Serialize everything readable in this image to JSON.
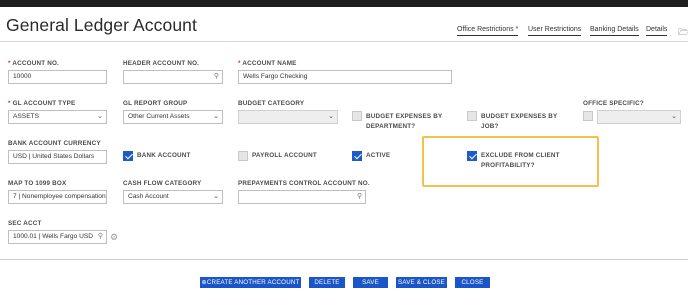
{
  "page": {
    "title": "General Ledger Account"
  },
  "tabs": [
    {
      "label": "Office Restrictions *"
    },
    {
      "label": "User Restrictions"
    },
    {
      "label": "Banking Details"
    },
    {
      "label": "Details"
    }
  ],
  "fields": {
    "account_no": {
      "label": "ACCOUNT NO.",
      "value": "10000"
    },
    "header_account_no": {
      "label": "HEADER ACCOUNT NO.",
      "value": ""
    },
    "account_name": {
      "label": "ACCOUNT NAME",
      "value": "Wells Fargo Checking"
    },
    "gl_account_type": {
      "label": "GL ACCOUNT TYPE",
      "value": "ASSETS"
    },
    "gl_report_group": {
      "label": "GL REPORT GROUP",
      "value": "Other Current Assets"
    },
    "budget_category": {
      "label": "BUDGET CATEGORY",
      "value": ""
    },
    "budget_expenses_department": {
      "label_line1": "BUDGET EXPENSES BY",
      "label_line2": "DEPARTMENT?",
      "checked": false
    },
    "budget_expenses_job": {
      "label_line1": "BUDGET EXPENSES BY",
      "label_line2": "JOB?",
      "checked": false
    },
    "office_specific": {
      "label": "OFFICE SPECIFIC?",
      "value": ""
    },
    "bank_account_currency": {
      "label": "BANK ACCOUNT CURRENCY",
      "value": "USD | United States Dollars"
    },
    "bank_account": {
      "label": "BANK ACCOUNT",
      "checked": true
    },
    "payroll_account": {
      "label": "PAYROLL ACCOUNT",
      "checked": false
    },
    "active": {
      "label": "ACTIVE",
      "checked": true
    },
    "exclude_profitability": {
      "label_line1": "EXCLUDE FROM CLIENT",
      "label_line2": "PROFITABILITY?",
      "checked": true
    },
    "map_1099": {
      "label": "MAP TO 1099 BOX",
      "value": "7 | Nonemployee compensation"
    },
    "cash_flow_category": {
      "label": "CASH FLOW CATEGORY",
      "value": "Cash Account"
    },
    "prepayments_control": {
      "label": "PREPAYMENTS CONTROL ACCOUNT NO.",
      "value": ""
    },
    "sec_acct": {
      "label": "SEC ACCT",
      "value": "1000.01 | Wells Fargo USD"
    }
  },
  "buttons": {
    "create_another": "CREATE ANOTHER ACCOUNT",
    "delete": "DELETE",
    "save": "SAVE",
    "save_close": "SAVE & CLOSE",
    "close": "CLOSE"
  },
  "icons": {
    "search": "search-icon",
    "dropdown": "chevron-down-icon",
    "gear": "gear-icon",
    "folder": "folder-icon",
    "add": "plus-circle-icon"
  },
  "colors": {
    "accent": "#1a56c9",
    "checkbox": "#1f5bc6",
    "highlight": "#f2c14e",
    "required": "#d62b2b"
  }
}
